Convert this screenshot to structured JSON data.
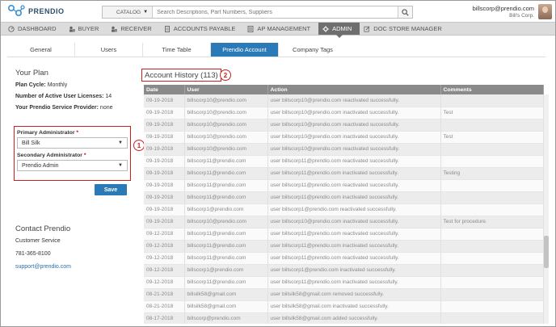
{
  "header": {
    "logo_text": "PRENDIO",
    "catalog_label": "CATALOG",
    "search_placeholder": "Search Descriptions, Part Numbers, Suppliers",
    "user_email": "billscorp@prendio.com",
    "user_company": "Bill's Corp."
  },
  "mainnav": [
    {
      "label": "DASHBOARD",
      "icon": "dashboard-icon"
    },
    {
      "label": "BUYER",
      "icon": "buyer-icon"
    },
    {
      "label": "RECEIVER",
      "icon": "receiver-icon"
    },
    {
      "label": "ACCOUNTS PAYABLE",
      "icon": "document-icon"
    },
    {
      "label": "AP MANAGEMENT",
      "icon": "ledger-icon"
    },
    {
      "label": "ADMIN",
      "icon": "gear-icon",
      "active": true
    },
    {
      "label": "DOC STORE MANAGER",
      "icon": "edit-icon"
    }
  ],
  "subtabs": [
    {
      "label": "General"
    },
    {
      "label": "Users"
    },
    {
      "label": "Time Table"
    },
    {
      "label": "Prendio Account",
      "active": true
    },
    {
      "label": "Company Tags"
    }
  ],
  "plan": {
    "title": "Your Plan",
    "cycle_label": "Plan Cycle:",
    "cycle_value": "Monthly",
    "licenses_label": "Number of Active User Licenses:",
    "licenses_value": "14",
    "provider_label": "Your Prendio Service Provider:",
    "provider_value": "none",
    "primary_admin_label": "Primary Administrator",
    "primary_admin_value": "Bill Silk",
    "secondary_admin_label": "Secondary Administrator",
    "secondary_admin_value": "Prendio Admin",
    "required_mark": "*",
    "save_label": "Save",
    "callout_1": "1"
  },
  "contact": {
    "title": "Contact Prendio",
    "service": "Customer Service",
    "phone": "781-365-8100",
    "email": "support@prendio.com"
  },
  "history": {
    "title": "Account History (113)",
    "callout_2": "2",
    "columns": [
      "Date",
      "User",
      "Action",
      "Comments"
    ],
    "rows": [
      [
        "09-19-2018",
        "billscorp10@prendio.com",
        "user billscorp10@prendio.com reactivated successfully.",
        ""
      ],
      [
        "09-19-2018",
        "billscorp10@prendio.com",
        "user billscorp10@prendio.com inactivated successfully.",
        "Test"
      ],
      [
        "09-19-2018",
        "billscorp10@prendio.com",
        "user billscorp10@prendio.com reactivated successfully.",
        ""
      ],
      [
        "09-19-2018",
        "billscorp10@prendio.com",
        "user billscorp10@prendio.com inactivated successfully.",
        "Test"
      ],
      [
        "09-19-2018",
        "billscorp10@prendio.com",
        "user billscorp10@prendio.com reactivated successfully.",
        ""
      ],
      [
        "09-19-2018",
        "billscorp11@prendio.com",
        "user billscorp11@prendio.com reactivated successfully.",
        ""
      ],
      [
        "09-19-2018",
        "billscorp11@prendio.com",
        "user billscorp11@prendio.com inactivated successfully.",
        "Testing"
      ],
      [
        "09-19-2018",
        "billscorp11@prendio.com",
        "user billscorp11@prendio.com reactivated successfully.",
        ""
      ],
      [
        "09-19-2018",
        "billscorp11@prendio.com",
        "user billscorp11@prendio.com inactivated successfully.",
        ""
      ],
      [
        "09-19-2018",
        "billscorp1@prendio.com",
        "user billscorp1@prendio.com reactivated successfully.",
        ""
      ],
      [
        "09-19-2018",
        "billscorp10@prendio.com",
        "user billscorp10@prendio.com inactivated successfully.",
        "Test for procedure."
      ],
      [
        "09-12-2018",
        "billscorp11@prendio.com",
        "user billscorp11@prendio.com reactivated successfully.",
        ""
      ],
      [
        "09-12-2018",
        "billscorp11@prendio.com",
        "user billscorp11@prendio.com inactivated successfully.",
        ""
      ],
      [
        "09-12-2018",
        "billscorp11@prendio.com",
        "user billscorp11@prendio.com reactivated successfully.",
        ""
      ],
      [
        "09-12-2018",
        "billscorp1@prendio.com",
        "user billscorp1@prendio.com inactivated successfully.",
        ""
      ],
      [
        "09-12-2018",
        "billscorp11@prendio.com",
        "user billscorp11@prendio.com inactivated successfully.",
        ""
      ],
      [
        "08-21-2018",
        "billsilk58@gmail.com",
        "user billsilk58@gmail.com removed successfully.",
        ""
      ],
      [
        "08-21-2018",
        "billsilk58@gmail.com",
        "user billsilk58@gmail.com inactivated successfully.",
        ""
      ],
      [
        "08-17-2018",
        "billscorp@prendio.com",
        "user billsilk58@gmail.com added successfully.",
        ""
      ]
    ]
  },
  "colors": {
    "accent": "#2a7ab8",
    "highlight": "#cc1f1f",
    "nav_active": "#6f6f6f"
  }
}
